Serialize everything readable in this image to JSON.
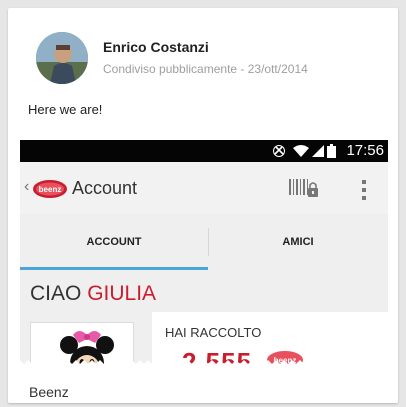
{
  "post": {
    "author": "Enrico Costanzi",
    "meta": "Condiviso pubblicamente  -  23/ott/2014",
    "text": "Here we are!"
  },
  "phone": {
    "status_time": "17:56",
    "status_icons": [
      "rotation-icon",
      "wifi-icon",
      "signal-icon",
      "battery-icon"
    ],
    "back_glyph": "‹",
    "logo_text": "beenz",
    "app_title": "Account",
    "tabs": [
      {
        "label": "ACCOUNT",
        "selected": true
      },
      {
        "label": "AMICI",
        "selected": false
      }
    ],
    "greeting_prefix": "CIAO",
    "greeting_name": "GIULIA",
    "collected_label": "HAI RACCOLTO",
    "collected_value": "2.555",
    "collected_unit_logo": "beenz"
  },
  "caption": {
    "title": "Beenz"
  },
  "colors": {
    "accent_red": "#c81e2e",
    "tab_indicator": "#4aa6d8",
    "status_bar": "#050505"
  }
}
